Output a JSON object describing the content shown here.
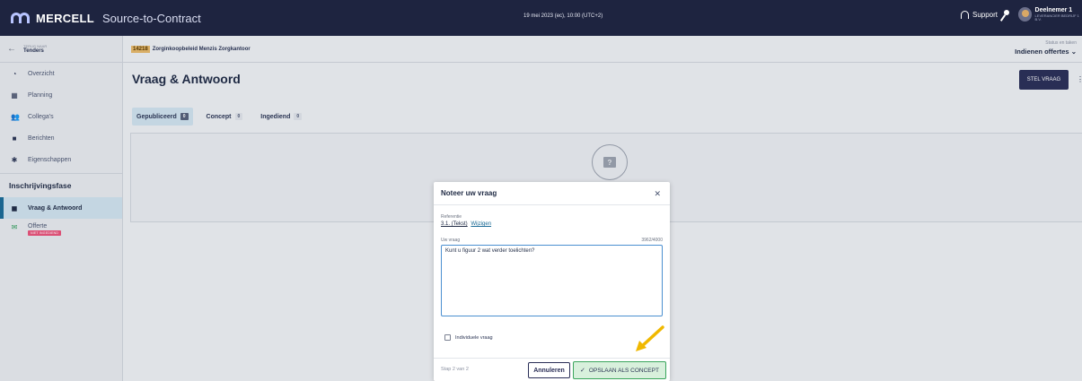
{
  "topbar": {
    "brand": "MERCELL",
    "brand_sub": "Source-to-Contract",
    "datetime": "19 mei 2023 (ec), 10:00 (UTC+2)",
    "support": "Support",
    "user_name": "Deelnemer 1",
    "user_org": "LEVERANCIER BEDRIJF 1 B.V."
  },
  "sidebar": {
    "back_small": "TERUG NAAR",
    "back_title": "Tenders",
    "nav": [
      {
        "label": "Overzicht",
        "icon": "dashboard-icon"
      },
      {
        "label": "Planning",
        "icon": "calendar-icon"
      },
      {
        "label": "Collega's",
        "icon": "users-icon"
      },
      {
        "label": "Berichten",
        "icon": "message-icon"
      },
      {
        "label": "Eigenschappen",
        "icon": "gear-icon"
      }
    ],
    "section": "Inschrijvingsfase",
    "active_item": "Vraag & Antwoord",
    "offerte": "Offerte",
    "offerte_badge": "NIET INGEDIEND"
  },
  "header": {
    "tender_id": "14218",
    "tender_name": "Zorginkoopbeleid Menzis Zorgkantoor",
    "status_label": "Status en taken",
    "status_value": "Indienen offertes"
  },
  "main": {
    "title": "Vraag & Antwoord",
    "stel_vraag": "STEL VRAAG",
    "tabs": [
      {
        "label": "Gepubliceerd",
        "count": "0"
      },
      {
        "label": "Concept",
        "count": "0"
      },
      {
        "label": "Ingediend",
        "count": "0"
      }
    ]
  },
  "modal": {
    "title": "Noteer uw vraag",
    "ref_label": "Referentie",
    "ref_value": "3.1. (Tekst)",
    "ref_link": "Wijzigen",
    "vraag_label": "Uw vraag",
    "char_count": "3962/4000",
    "vraag_value": "Kunt u figuur 2 wat verder toelichten?",
    "checkbox_label": "Individuele vraag",
    "step": "Stap 2 van 2",
    "cancel": "Annuleren",
    "save": "OPSLAAN ALS CONCEPT"
  }
}
